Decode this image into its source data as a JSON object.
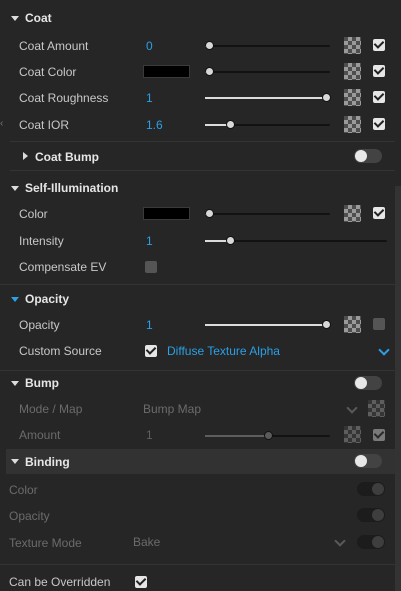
{
  "sections": {
    "coat": {
      "title": "Coat",
      "amount": {
        "label": "Coat Amount",
        "value": "0"
      },
      "color": {
        "label": "Coat Color"
      },
      "roughness": {
        "label": "Coat Roughness",
        "value": "1"
      },
      "ior": {
        "label": "Coat IOR",
        "value": "1.6"
      },
      "bump": {
        "title": "Coat Bump"
      }
    },
    "self_illumination": {
      "title": "Self-Illumination",
      "color": {
        "label": "Color"
      },
      "intensity": {
        "label": "Intensity",
        "value": "1"
      },
      "compensate": {
        "label": "Compensate EV"
      }
    },
    "opacity": {
      "title": "Opacity",
      "opacity": {
        "label": "Opacity",
        "value": "1"
      },
      "custom_source": {
        "label": "Custom Source",
        "value": "Diffuse Texture Alpha"
      }
    },
    "bump": {
      "title": "Bump",
      "mode": {
        "label": "Mode / Map",
        "value": "Bump Map"
      },
      "amount": {
        "label": "Amount",
        "value": "1"
      }
    },
    "binding": {
      "title": "Binding",
      "color": {
        "label": "Color"
      },
      "opacity": {
        "label": "Opacity"
      },
      "texture_mode": {
        "label": "Texture Mode",
        "value": "Bake"
      }
    },
    "override": {
      "label": "Can be Overridden"
    }
  },
  "slider_levels": {
    "coat_amount": 0,
    "coat_color": 0,
    "coat_roughness": 1,
    "coat_ior": 0.18,
    "self_color": 0,
    "self_intensity": 0.12,
    "opacity": 1,
    "bump_amount": 0.5
  },
  "colors": {
    "accent": "#2aa0e6",
    "background": "#262626",
    "header_bg": "#323232"
  }
}
